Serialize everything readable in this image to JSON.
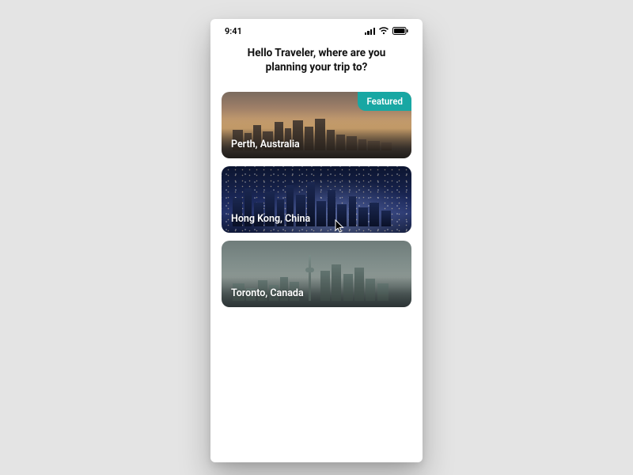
{
  "status_bar": {
    "time": "9:41"
  },
  "heading": {
    "line1": "Hello Traveler, where are you",
    "line2": "planning your trip to?"
  },
  "featured_label": "Featured",
  "accent_color": "#18a7a3",
  "destinations": [
    {
      "label": "Perth, Australia",
      "featured": true
    },
    {
      "label": "Hong Kong, China",
      "featured": false
    },
    {
      "label": "Toronto, Canada",
      "featured": false
    }
  ]
}
